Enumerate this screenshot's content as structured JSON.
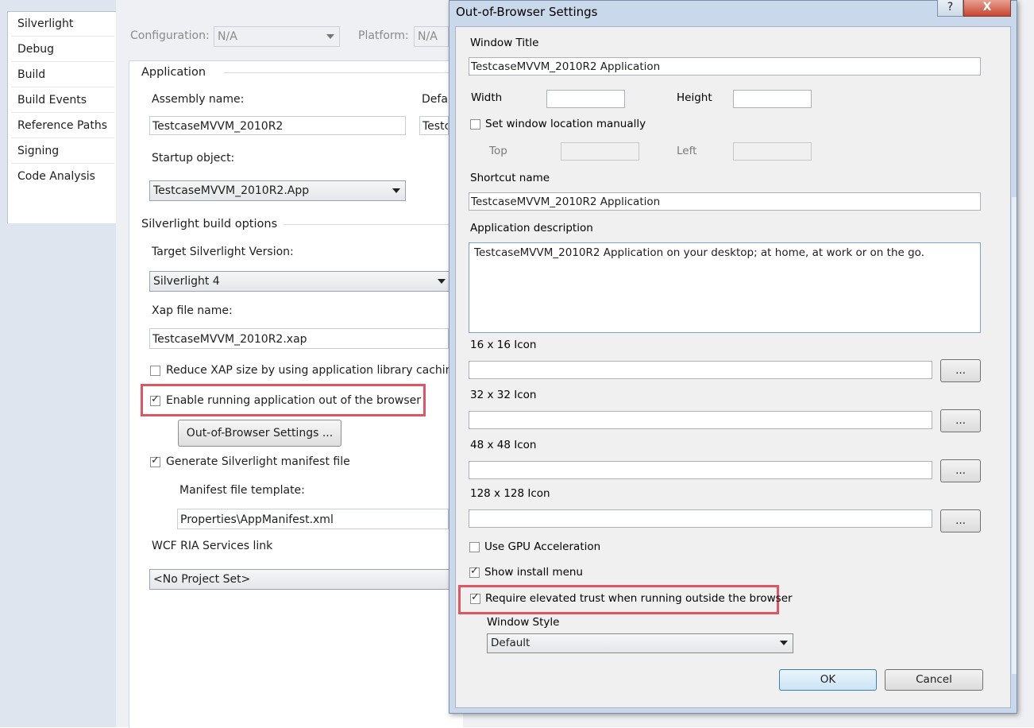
{
  "nav": {
    "items": [
      "Silverlight",
      "Debug",
      "Build",
      "Build Events",
      "Reference Paths",
      "Signing",
      "Code Analysis"
    ]
  },
  "toolbar": {
    "configuration_label": "Configuration:",
    "configuration_value": "N/A",
    "platform_label": "Platform:",
    "platform_value": "N/A"
  },
  "application": {
    "section_title": "Application",
    "assembly_label": "Assembly name:",
    "assembly_value": "TestcaseMVVM_2010R2",
    "default_label": "Defa",
    "default_value": "Testc",
    "startup_label": "Startup object:",
    "startup_value": "TestcaseMVVM_2010R2.App"
  },
  "build_options": {
    "section_title": "Silverlight build options",
    "target_label": "Target Silverlight Version:",
    "target_value": "Silverlight 4",
    "xap_label": "Xap file name:",
    "xap_value": "TestcaseMVVM_2010R2.xap",
    "reduce_label": "Reduce XAP size by using application library caching",
    "reduce_checked": false,
    "oob_label": "Enable running application out of the browser",
    "oob_checked": true,
    "oob_button": "Out-of-Browser Settings ...",
    "manifest_label": "Generate Silverlight manifest file",
    "manifest_checked": true,
    "manifest_template_label": "Manifest file template:",
    "manifest_template_value": "Properties\\AppManifest.xml",
    "wcf_label": "WCF RIA Services link",
    "wcf_value": "<No Project Set>"
  },
  "dialog": {
    "title": "Out-of-Browser Settings",
    "help_button": "?",
    "close_button": "X",
    "window_title_label": "Window Title",
    "window_title_value": "TestcaseMVVM_2010R2 Application",
    "width_label": "Width",
    "width_value": "",
    "height_label": "Height",
    "height_value": "",
    "set_location_label": "Set window location manually",
    "set_location_checked": false,
    "top_label": "Top",
    "top_value": "",
    "left_label": "Left",
    "left_value": "",
    "shortcut_label": "Shortcut name",
    "shortcut_value": "TestcaseMVVM_2010R2 Application",
    "description_label": "Application description",
    "description_value": "TestcaseMVVM_2010R2 Application on your desktop; at home, at work or on the go.",
    "icon16_label": "16 x 16 Icon",
    "icon32_label": "32 x 32 Icon",
    "icon48_label": "48 x 48 Icon",
    "icon128_label": "128 x 128 Icon",
    "browse_label": "...",
    "gpu_label": "Use GPU Acceleration",
    "gpu_checked": false,
    "install_menu_label": "Show install menu",
    "install_menu_checked": true,
    "elevated_label": "Require elevated trust when running outside the browser",
    "elevated_checked": true,
    "window_style_label": "Window Style",
    "window_style_value": "Default",
    "ok_button": "OK",
    "cancel_button": "Cancel"
  }
}
